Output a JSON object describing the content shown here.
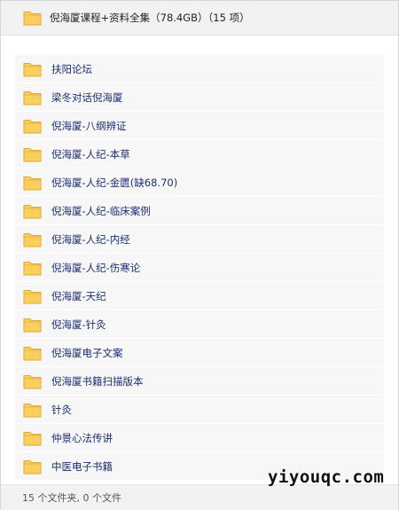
{
  "header": {
    "title": "倪海厦课程+资料全集（78.4GB）（15 项）",
    "icon": "folder-icon"
  },
  "folders": [
    {
      "label": "扶阳论坛"
    },
    {
      "label": "梁冬对话倪海厦"
    },
    {
      "label": "倪海厦-八纲辨证"
    },
    {
      "label": "倪海厦-人纪-本草"
    },
    {
      "label": "倪海厦-人纪-金匮(缺68.70)"
    },
    {
      "label": "倪海厦-人纪-临床案例"
    },
    {
      "label": "倪海厦-人纪-内经"
    },
    {
      "label": "倪海厦-人纪-伤寒论"
    },
    {
      "label": "倪海厦-天纪"
    },
    {
      "label": "倪海厦-针灸"
    },
    {
      "label": "倪海厦电子文案"
    },
    {
      "label": "倪海厦书籍扫描版本"
    },
    {
      "label": "针灸"
    },
    {
      "label": "仲景心法传讲"
    },
    {
      "label": "中医电子书籍"
    }
  ],
  "footer": {
    "status": "15 个文件夹, 0 个文件"
  },
  "watermark": "yiyouqc.com",
  "colors": {
    "folder_fill": "#f9cf5e",
    "folder_stroke": "#e3a832",
    "label_text": "#1c2f6e",
    "row_bg": "#f7f7f7"
  }
}
